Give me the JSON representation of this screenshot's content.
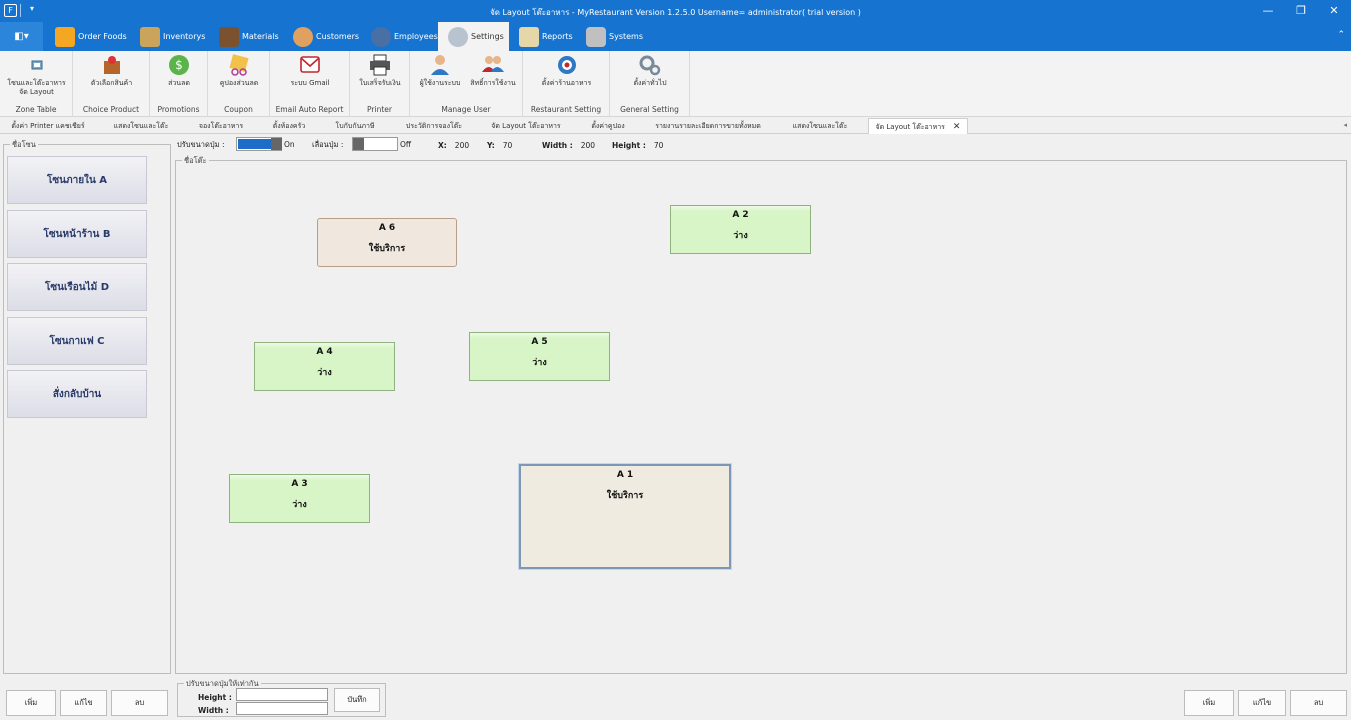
{
  "window": {
    "title": "จัด Layout โต๊ะอาหาร - MyRestaurant Version 1.2.5.0 Username= administrator( trial version )",
    "app_icon": "F",
    "quick_access": "▾",
    "minimize": "—",
    "restore": "❐",
    "close": "✕"
  },
  "ribbon_tabs": [
    {
      "label": "Order Foods",
      "icon": "order-icon",
      "color": "#f5a623"
    },
    {
      "label": "Inventorys",
      "icon": "box-icon",
      "color": "#c9a45a"
    },
    {
      "label": "Materials",
      "icon": "books-icon",
      "color": "#7a5230"
    },
    {
      "label": "Customers",
      "icon": "customer-icon",
      "color": "#e0a060"
    },
    {
      "label": "Employees",
      "icon": "employee-icon",
      "color": "#4a6fa5"
    },
    {
      "label": "Settings",
      "icon": "gear-icon",
      "color": "#9aa8b8"
    },
    {
      "label": "Reports",
      "icon": "report-icon",
      "color": "#e6d7a8"
    },
    {
      "label": "Systems",
      "icon": "lock-icon",
      "color": "#c0c0c0"
    }
  ],
  "active_tab": "Settings",
  "app_menu_icon": "◧▾",
  "collapse_icon": "⌃",
  "ribbon_groups": [
    {
      "caption": "Zone Table",
      "buttons": [
        {
          "label_line1": "โซนและโต๊ะอาหาร",
          "label_line2": "จัด Layout"
        }
      ]
    },
    {
      "caption": "Choice Product",
      "buttons": [
        {
          "label_line1": "ตัวเลือกสินค้า",
          "label_line2": ""
        }
      ]
    },
    {
      "caption": "Promotions",
      "buttons": [
        {
          "label_line1": "ส่วนลด",
          "label_line2": ""
        }
      ]
    },
    {
      "caption": "Coupon",
      "buttons": [
        {
          "label_line1": "คูปองส่วนลด",
          "label_line2": ""
        }
      ]
    },
    {
      "caption": "Email Auto Report",
      "buttons": [
        {
          "label_line1": "ระบบ Gmail",
          "label_line2": ""
        }
      ]
    },
    {
      "caption": "Printer",
      "buttons": [
        {
          "label_line1": "ใบเสร็จรับเงิน",
          "label_line2": ""
        }
      ]
    },
    {
      "caption": "Manage User",
      "buttons": [
        {
          "label_line1": "ผู้ใช้งานระบบ",
          "label_line2": ""
        },
        {
          "label_line1": "สิทธิ์การใช้งาน",
          "label_line2": ""
        }
      ]
    },
    {
      "caption": "Restaurant Setting",
      "buttons": [
        {
          "label_line1": "ตั้งค่าร้านอาหาร",
          "label_line2": ""
        }
      ]
    },
    {
      "caption": "General Setting",
      "buttons": [
        {
          "label_line1": "ตั้งค่าทั่วไป",
          "label_line2": ""
        }
      ]
    }
  ],
  "doc_tabs": [
    "ตั้งค่า Printer แคชเชียร์",
    "แสดงโซนและโต๊ะ",
    "จองโต๊ะอาหาร",
    "ตั้งห้องครัว",
    "โบกับกันภาษี",
    "ประวัติการจองโต๊ะ",
    "จัด Layout โต๊ะอาหาร",
    "ตั้งค่าคูปอง",
    "รายงานรายละเอียดการขายทั้งหมด",
    "แสดงโซนและโต๊ะ",
    "จัด Layout โต๊ะอาหาร"
  ],
  "doc_tab_close": "✕",
  "doc_tab_scroll": "◂",
  "zone_panel": {
    "label": "ชื่อโซน",
    "zones": [
      "โซนภายใน A",
      "โซนหน้าร้าน B",
      "โซนเรือนไม้ D",
      "โซนกาแฟ C",
      "สั่งกลับบ้าน"
    ]
  },
  "controls": {
    "resize_label": "ปรับขนาดปุ่ม :",
    "resize_state": "On",
    "move_label": "เลื่อนปุ่ม :",
    "move_state": "Off",
    "x_label": "X:",
    "x_value": "200",
    "y_label": "Y:",
    "y_value": "70",
    "width_label": "Width :",
    "width_value": "200",
    "height_label": "Height :",
    "height_value": "70"
  },
  "table_area": {
    "label": "ชื่อโต๊ะ",
    "tables": [
      {
        "name": "A 6",
        "status": "ใช้บริการ",
        "state": "busy"
      },
      {
        "name": "A 2",
        "status": "ว่าง",
        "state": "free"
      },
      {
        "name": "A 4",
        "status": "ว่าง",
        "state": "free"
      },
      {
        "name": "A 5",
        "status": "ว่าง",
        "state": "free"
      },
      {
        "name": "A 3",
        "status": "ว่าง",
        "state": "free"
      },
      {
        "name": "A 1",
        "status": "ใช้บริการ",
        "state": "selected"
      }
    ]
  },
  "equal_size": {
    "label": "ปรับขนาดปุ่มให้เท่ากัน",
    "height_label": "Height :",
    "width_label": "Width :",
    "save_label": "บันทึก"
  },
  "zone_actions": {
    "add": "เพิ่ม",
    "edit": "แก้ไข",
    "delete": "ลบ"
  },
  "table_actions": {
    "add": "เพิ่ม",
    "edit": "แก้ไข",
    "delete": "ลบ"
  }
}
